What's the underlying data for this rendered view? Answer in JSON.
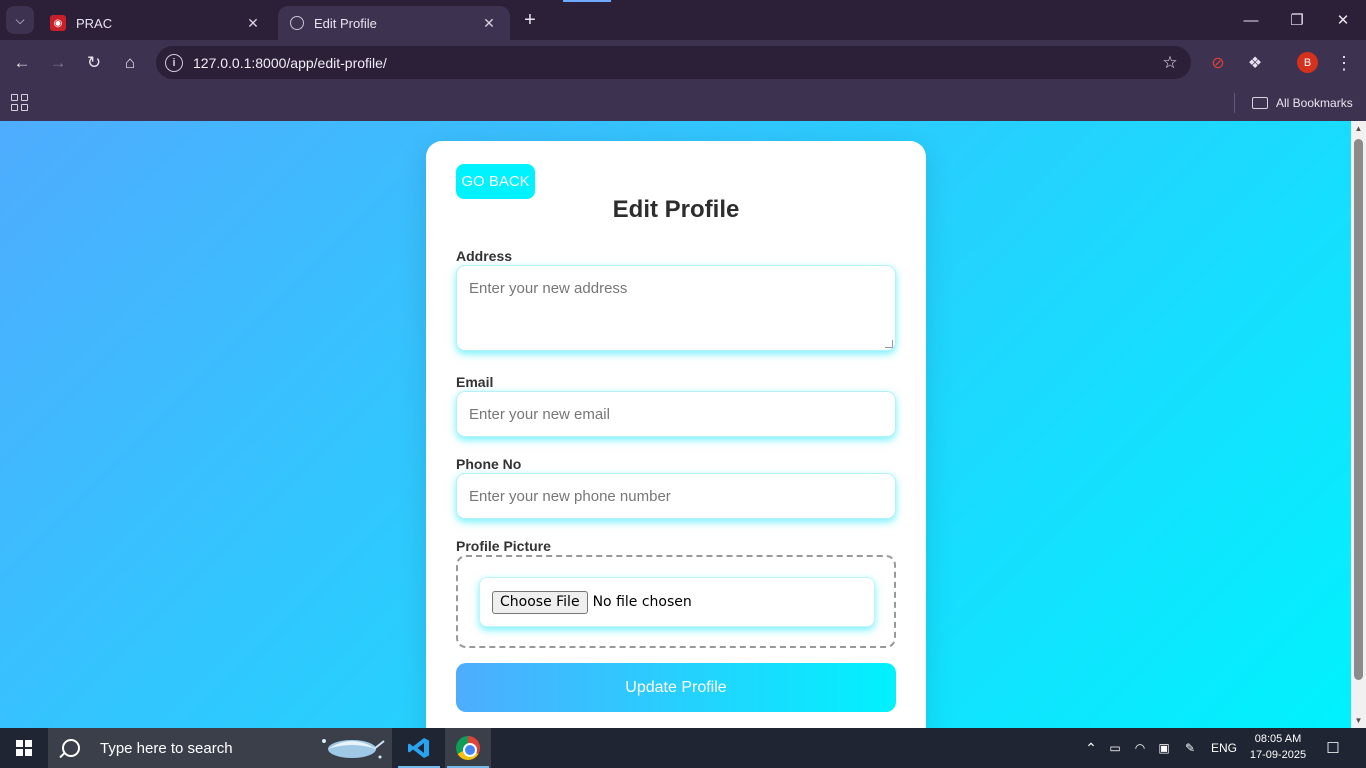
{
  "browser": {
    "tabs": [
      {
        "title": "PRAC",
        "favicon": "prac-favicon",
        "active": false
      },
      {
        "title": "Edit Profile",
        "favicon": "globe-icon",
        "active": true
      }
    ],
    "url": "127.0.0.1:8000/app/edit-profile/",
    "bookmarks_label": "All Bookmarks",
    "profile_initial": "B"
  },
  "page": {
    "back_button": "GO BACK",
    "title": "Edit Profile",
    "fields": {
      "address": {
        "label": "Address",
        "placeholder": "Enter your new address"
      },
      "email": {
        "label": "Email",
        "placeholder": "Enter your new email"
      },
      "phone": {
        "label": "Phone No",
        "placeholder": "Enter your new phone number"
      },
      "picture": {
        "label": "Profile Picture",
        "button": "Choose File",
        "status": "No file chosen"
      }
    },
    "submit": "Update Profile",
    "colors": {
      "gradient_start": "#4facfe",
      "gradient_end": "#00f2fe",
      "back_button": "#00f2fe"
    }
  },
  "taskbar": {
    "search_placeholder": "Type here to search",
    "language": "ENG",
    "time": "08:05 AM",
    "date": "17-09-2025"
  }
}
